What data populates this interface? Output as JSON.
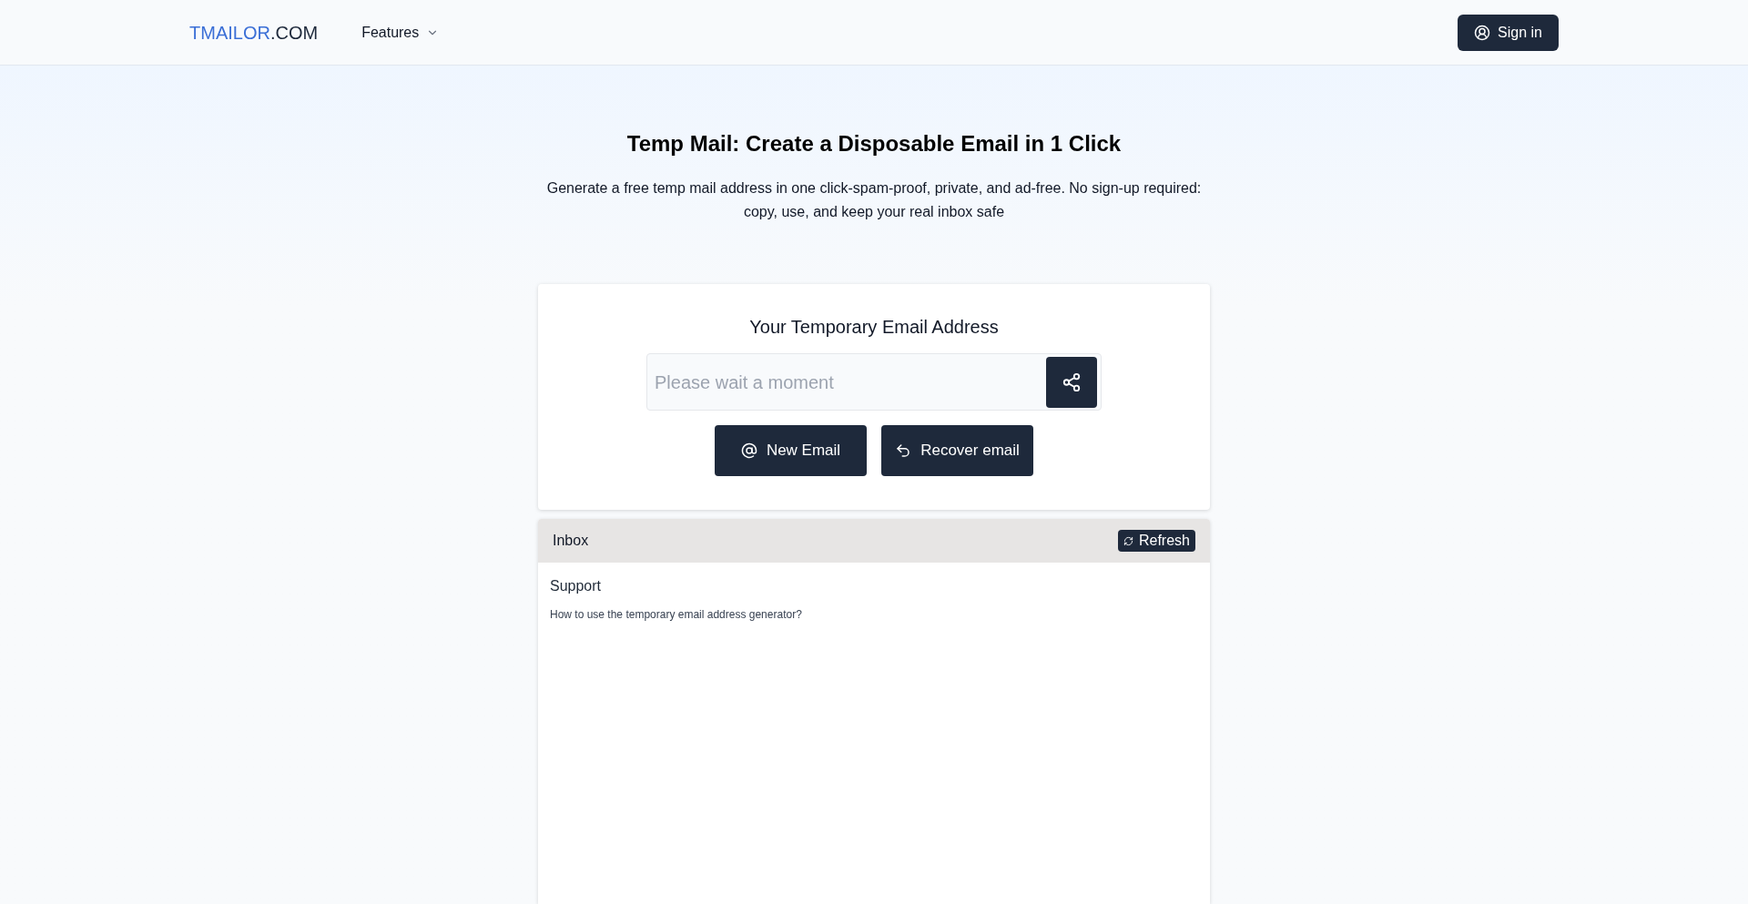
{
  "header": {
    "logo": {
      "brand": "TMAILOR",
      "suffix": ".COM"
    },
    "nav": [
      {
        "label": "Features",
        "kind": "dropdown"
      }
    ],
    "sign_in": "Sign in"
  },
  "hero": {
    "title": "Temp Mail: Create a Disposable Email in 1 Click",
    "subtitle": "Generate a free temp mail address in one click-spam-proof, private, and ad-free. No sign-up required: copy, use, and keep your real inbox safe"
  },
  "address_card": {
    "title": "Your Temporary Email Address",
    "placeholder": "Please wait a moment",
    "buttons": [
      {
        "label": "New Email",
        "kind": "new"
      },
      {
        "label": "Recover email",
        "kind": "recover"
      }
    ]
  },
  "inbox": {
    "title": "Inbox",
    "refresh": "Refresh",
    "messages": [
      {
        "sender": "Support",
        "subject": "How to use the temporary email address generator?"
      }
    ]
  }
}
